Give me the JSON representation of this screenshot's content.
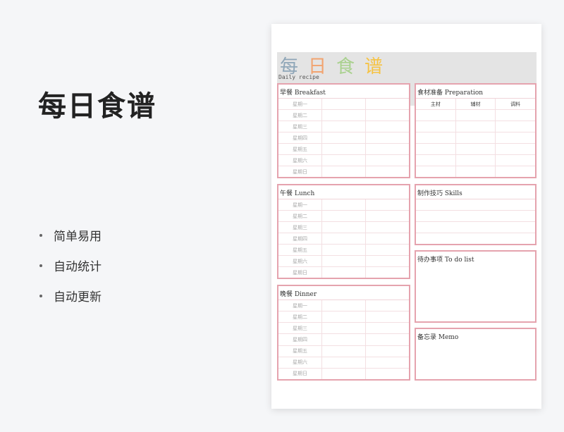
{
  "promo": {
    "title": "每日食谱",
    "features": [
      "简单易用",
      "自动统计",
      "自动更新"
    ]
  },
  "sheet": {
    "title_chars": [
      {
        "char": "每",
        "color": "#8fa6b8"
      },
      {
        "char": "日",
        "color": "#f2a36f"
      },
      {
        "char": "食",
        "color": "#a9d18e"
      },
      {
        "char": "谱",
        "color": "#f6c343"
      }
    ],
    "subtitle": "Daily recipe",
    "weekdays": [
      "星期一",
      "星期二",
      "星期三",
      "星期四",
      "星期五",
      "星期六",
      "星期日"
    ],
    "breakfast": {
      "title": "早餐 Breakfast"
    },
    "lunch": {
      "title": "午餐 Lunch"
    },
    "dinner": {
      "title": "晚餐 Dinner"
    },
    "preparation": {
      "title": "食材准备 Preparation",
      "headers": [
        "主材",
        "辅材",
        "调料"
      ]
    },
    "skills": {
      "title": "制作技巧 Skills"
    },
    "todo": {
      "title": "待办事项 To do list"
    },
    "memo": {
      "title": "备忘录 Memo"
    }
  },
  "colors": {
    "box_border": "#e5a3ae",
    "header_band": "#e4e4e4"
  }
}
